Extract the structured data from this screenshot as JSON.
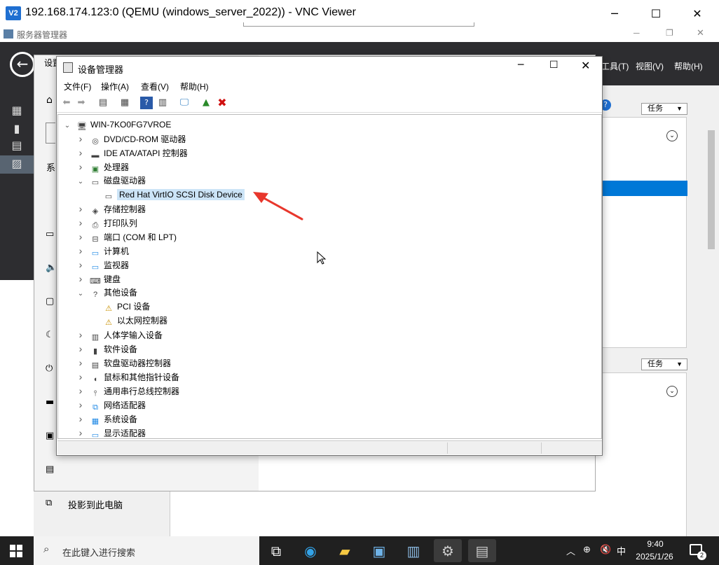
{
  "vnc": {
    "logo": "V2",
    "title": "192.168.174.123:0 (QEMU (windows_server_2022)) - VNC Viewer",
    "minimize": "─",
    "maximize": "☐",
    "close": "✕"
  },
  "server_manager": {
    "title": "服务器管理器",
    "menu": [
      "工具(T)",
      "视图(V)",
      "帮助(H)"
    ],
    "tasks_label_1": "任务",
    "tasks_label_2": "任务"
  },
  "settings": {
    "title_partial": "设置",
    "section_partial": "系",
    "bottom_item": "投影到此电脑"
  },
  "device_manager": {
    "title": "设备管理器",
    "menu": [
      "文件(F)",
      "操作(A)",
      "查看(V)",
      "帮助(H)"
    ],
    "tree": [
      {
        "label": "WIN-7KO0FG7VROE",
        "level": 0,
        "expanded": true,
        "icon": "computer-icon"
      },
      {
        "label": "DVD/CD-ROM 驱动器",
        "level": 1,
        "expanded": false,
        "icon": "dvd-drive-icon"
      },
      {
        "label": "IDE ATA/ATAPI 控制器",
        "level": 1,
        "expanded": false,
        "icon": "ide-controller-icon"
      },
      {
        "label": "处理器",
        "level": 1,
        "expanded": false,
        "icon": "processor-icon"
      },
      {
        "label": "磁盘驱动器",
        "level": 1,
        "expanded": true,
        "icon": "disk-drive-icon"
      },
      {
        "label": "Red Hat VirtIO SCSI Disk Device",
        "level": 2,
        "expanded": null,
        "icon": "disk-icon",
        "selected": true
      },
      {
        "label": "存储控制器",
        "level": 1,
        "expanded": false,
        "icon": "storage-controller-icon"
      },
      {
        "label": "打印队列",
        "level": 1,
        "expanded": false,
        "icon": "printer-icon"
      },
      {
        "label": "端口 (COM 和 LPT)",
        "level": 1,
        "expanded": false,
        "icon": "port-icon"
      },
      {
        "label": "计算机",
        "level": 1,
        "expanded": false,
        "icon": "monitor-icon"
      },
      {
        "label": "监视器",
        "level": 1,
        "expanded": false,
        "icon": "monitor-icon"
      },
      {
        "label": "键盘",
        "level": 1,
        "expanded": false,
        "icon": "keyboard-icon"
      },
      {
        "label": "其他设备",
        "level": 1,
        "expanded": true,
        "icon": "unknown-device-icon"
      },
      {
        "label": "PCI 设备",
        "level": 2,
        "expanded": null,
        "icon": "warning-device-icon"
      },
      {
        "label": "以太网控制器",
        "level": 2,
        "expanded": null,
        "icon": "warning-device-icon"
      },
      {
        "label": "人体学输入设备",
        "level": 1,
        "expanded": false,
        "icon": "hid-icon"
      },
      {
        "label": "软件设备",
        "level": 1,
        "expanded": false,
        "icon": "software-device-icon"
      },
      {
        "label": "软盘驱动器控制器",
        "level": 1,
        "expanded": false,
        "icon": "floppy-controller-icon"
      },
      {
        "label": "鼠标和其他指针设备",
        "level": 1,
        "expanded": false,
        "icon": "mouse-icon"
      },
      {
        "label": "通用串行总线控制器",
        "level": 1,
        "expanded": false,
        "icon": "usb-icon"
      },
      {
        "label": "网络适配器",
        "level": 1,
        "expanded": false,
        "icon": "network-adapter-icon"
      },
      {
        "label": "系统设备",
        "level": 1,
        "expanded": false,
        "icon": "system-device-icon"
      },
      {
        "label": "显示适配器",
        "level": 1,
        "expanded": false,
        "icon": "display-adapter-icon"
      }
    ]
  },
  "taskbar": {
    "search_placeholder": "在此键入进行搜索",
    "ime": "中",
    "time": "9:40",
    "date": "2025/1/26",
    "notification_count": "2"
  },
  "colors": {
    "accent": "#0078d7",
    "selection": "#cce4f7",
    "annotation_arrow": "#e8372c"
  }
}
